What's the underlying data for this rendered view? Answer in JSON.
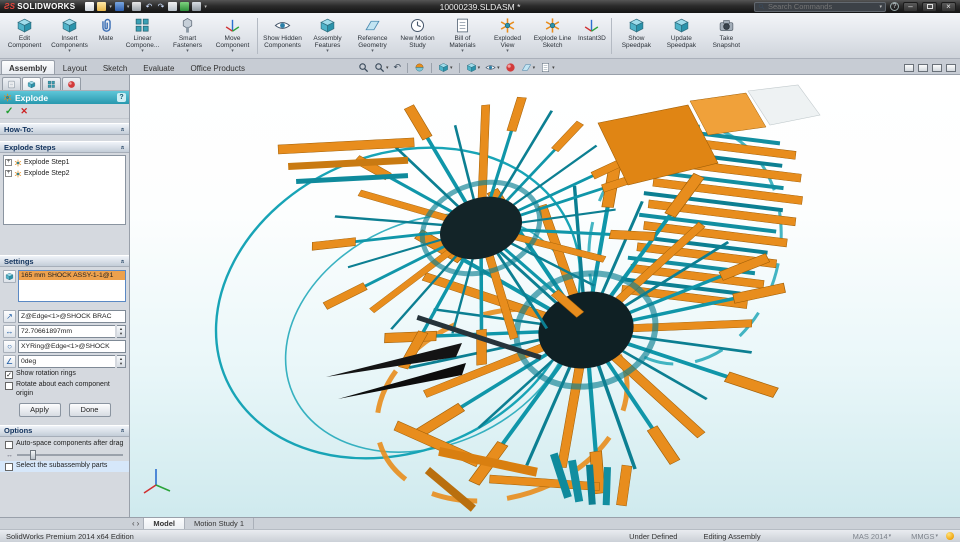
{
  "glyphs": {
    "caret": "▾",
    "chevron": "»",
    "plus": "+",
    "check": "✓",
    "cross": "✕",
    "spin_up": "▴",
    "spin_down": "▾",
    "undo": "↶",
    "redo": "↷",
    "tab_left": "‹",
    "tab_right": "›",
    "help": "?",
    "direction_arrow": "↗",
    "distance_arrow": "↔",
    "ring_circle": "○",
    "angle_sign": "∠",
    "minimize": "–",
    "close": "×"
  },
  "titlebar": {
    "logo_glyph": "ƧS",
    "brand": "SOLIDWORKS",
    "document_title": "10000239.SLDASM *",
    "search_placeholder": "Search Commands"
  },
  "ribbon": {
    "tabs": [
      "Assembly",
      "Layout",
      "Sketch",
      "Evaluate",
      "Office Products"
    ],
    "active_tab": "Assembly",
    "buttons": [
      {
        "label": "Edit Component"
      },
      {
        "label": "Insert Components"
      },
      {
        "label": "Mate"
      },
      {
        "label": "Linear Compone..."
      },
      {
        "label": "Smart Fasteners"
      },
      {
        "label": "Move Component"
      },
      {
        "label": "Show Hidden Components"
      },
      {
        "label": "Assembly Features"
      },
      {
        "label": "Reference Geometry"
      },
      {
        "label": "New Motion Study"
      },
      {
        "label": "Bill of Materials"
      },
      {
        "label": "Exploded View"
      },
      {
        "label": "Explode Line Sketch"
      },
      {
        "label": "Instant3D"
      },
      {
        "label": "Show Speedpak"
      },
      {
        "label": "Update Speedpak"
      },
      {
        "label": "Take Snapshot"
      }
    ]
  },
  "property_manager": {
    "title": "Explode",
    "howto_label": "How-To:",
    "steps": {
      "header": "Explode Steps",
      "items": [
        "Explode Step1",
        "Explode Step2"
      ]
    },
    "settings": {
      "header": "Settings",
      "selected_component": "165 mm SHOCK ASSY-1-1@1",
      "explode_direction": "Z@Edge<1>@SHOCK BRAC",
      "explode_distance": "72.70661897mm",
      "rotation_axis": "XYRing@Edge<1>@SHOCK",
      "rotation_angle": "0deg",
      "show_rotation_rings_label": "Show rotation rings",
      "show_rotation_rings_checked": true,
      "rotate_about_origin_label": "Rotate about each component origin",
      "rotate_about_origin_checked": false,
      "apply_label": "Apply",
      "done_label": "Done"
    },
    "options": {
      "header": "Options",
      "autospace_label": "Auto-space components after drag",
      "autospace_checked": false,
      "subassembly_label": "Select the subassembly parts"
    }
  },
  "viewport_colors": {
    "teal": "#1096a9",
    "teal_dark": "#0c7f92",
    "orange": "#e88d1d",
    "dark": "#15262b"
  },
  "bottom": {
    "tabs": [
      "Model",
      "Motion Study 1"
    ],
    "active_tab": "Model"
  },
  "statusbar": {
    "edition": "SolidWorks Premium 2014 x64 Edition",
    "constraint_status": "Under Defined",
    "mode": "Editing Assembly",
    "config": "MAS 2014",
    "units": "MMGS"
  }
}
